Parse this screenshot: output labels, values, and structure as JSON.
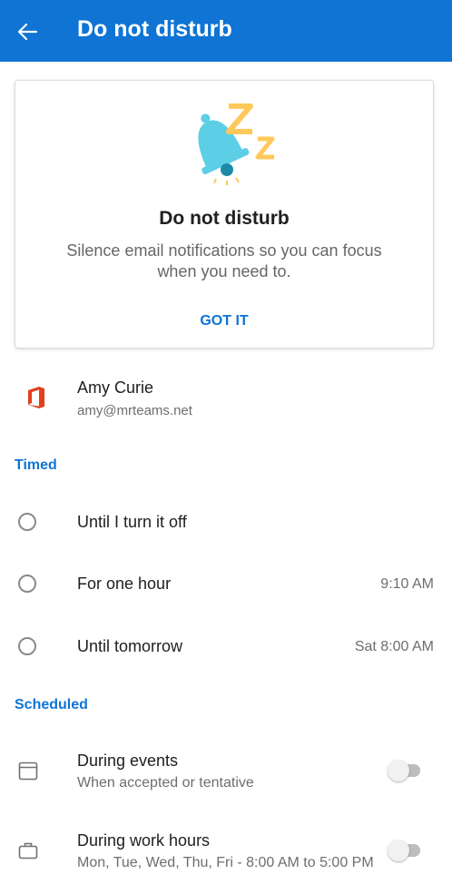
{
  "appbar": {
    "title": "Do not disturb"
  },
  "card": {
    "title": "Do not disturb",
    "description": "Silence email notifications so you can focus when you need to.",
    "action": "GOT IT"
  },
  "account": {
    "name": "Amy Curie",
    "email": "amy@mrteams.net"
  },
  "timed": {
    "header": "Timed",
    "options": [
      {
        "label": "Until I turn it off",
        "time": ""
      },
      {
        "label": "For one hour",
        "time": "9:10 AM"
      },
      {
        "label": "Until tomorrow",
        "time": "Sat 8:00 AM"
      }
    ]
  },
  "scheduled": {
    "header": "Scheduled",
    "items": [
      {
        "label": "During events",
        "sublabel": "When accepted or tentative",
        "icon": "calendar-icon",
        "enabled": false
      },
      {
        "label": "During work hours",
        "sublabel": "Mon, Tue, Wed, Thu, Fri - 8:00 AM to 5:00 PM",
        "icon": "briefcase-icon",
        "enabled": false
      }
    ]
  },
  "colors": {
    "accent": "#0f74d4",
    "bell": "#5ccfe6",
    "zzz": "#ffc85a"
  }
}
